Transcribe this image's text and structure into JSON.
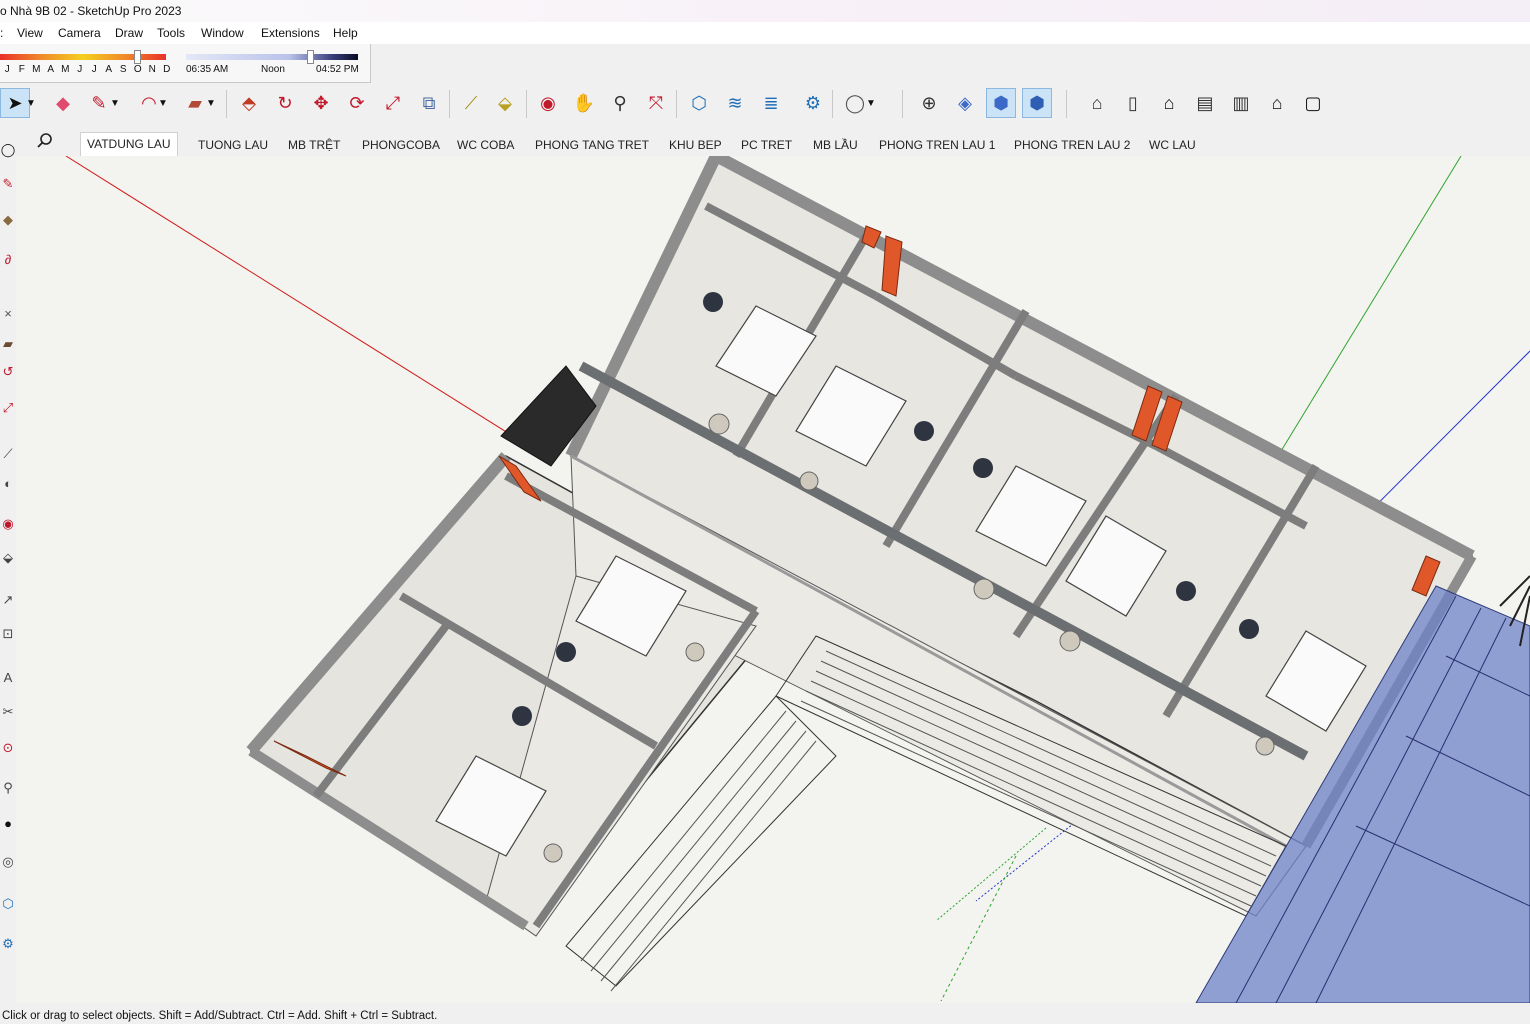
{
  "window": {
    "title": "o Nhà 9B 02 - SketchUp Pro 2023"
  },
  "menu": [
    "View",
    "Camera",
    "Draw",
    "Tools",
    "Window",
    "Extensions",
    "Help"
  ],
  "shadows": {
    "months": [
      "J",
      "F",
      "M",
      "A",
      "M",
      "J",
      "J",
      "A",
      "S",
      "O",
      "N",
      "D"
    ],
    "month_position": 0.81,
    "time_start": "06:35 AM",
    "time_noon": "Noon",
    "time_end": "04:52 PM",
    "time_position": 0.7
  },
  "toolbar": {
    "tools": [
      {
        "name": "select-icon",
        "glyph": "➤"
      },
      {
        "name": "eraser-icon",
        "glyph": "◆"
      },
      {
        "name": "pencil-icon",
        "glyph": "✎"
      },
      {
        "name": "arc-icon",
        "glyph": "◠"
      },
      {
        "name": "rectangle-icon",
        "glyph": "▰"
      },
      {
        "name": "push-pull-icon",
        "glyph": "⬘"
      },
      {
        "name": "follow-me-icon",
        "glyph": "↻"
      },
      {
        "name": "move-icon",
        "glyph": "✥"
      },
      {
        "name": "rotate-icon",
        "glyph": "⟳"
      },
      {
        "name": "scale-icon",
        "glyph": "⤢"
      },
      {
        "name": "offset-icon",
        "glyph": "⧉"
      },
      {
        "name": "tape-measure-icon",
        "glyph": "⟋"
      },
      {
        "name": "paint-bucket-icon",
        "glyph": "⬙"
      },
      {
        "name": "orbit-icon",
        "glyph": "◉"
      },
      {
        "name": "pan-icon",
        "glyph": "✋"
      },
      {
        "name": "zoom-icon",
        "glyph": "⚲"
      },
      {
        "name": "zoom-extents-icon",
        "glyph": "⤧"
      },
      {
        "name": "warehouse-icon",
        "glyph": "⬡"
      },
      {
        "name": "extension-warehouse-icon",
        "glyph": "≋"
      },
      {
        "name": "layout-icon",
        "glyph": "≣"
      },
      {
        "name": "extension-manager-icon",
        "glyph": "⚙"
      },
      {
        "name": "account-icon",
        "glyph": "◯"
      },
      {
        "name": "section-plane-icon",
        "glyph": "⊕"
      },
      {
        "name": "xray-icon",
        "glyph": "◈"
      },
      {
        "name": "back-edges-icon",
        "glyph": "⬢"
      },
      {
        "name": "shaded-icon",
        "glyph": "⬢"
      },
      {
        "name": "iso-view-icon",
        "glyph": "⌂"
      },
      {
        "name": "top-view-icon",
        "glyph": "▯"
      },
      {
        "name": "front-view-icon",
        "glyph": "⌂"
      },
      {
        "name": "right-view-icon",
        "glyph": "▤"
      },
      {
        "name": "back-view-icon",
        "glyph": "▥"
      },
      {
        "name": "left-view-icon",
        "glyph": "⌂"
      },
      {
        "name": "bottom-view-icon",
        "glyph": "▢"
      }
    ]
  },
  "scene_tabs": [
    "VATDUNG LAU",
    "TUONG LAU",
    "MB TRỆT",
    "PHONGCOBA",
    "WC COBA",
    "PHONG TANG TRET",
    "KHU BEP",
    "PC TRET",
    "MB LẦU",
    "PHONG TREN LAU 1",
    "PHONG TREN LAU 2",
    "WC LAU"
  ],
  "active_tab": "VATDUNG LAU",
  "status": "Click or drag to select objects. Shift = Add/Subtract. Ctrl = Add. Shift + Ctrl = Subtract.",
  "colors": {
    "axis_red": "#d21a1a",
    "axis_green": "#2ea52e",
    "axis_blue": "#2233cc",
    "wall_gray": "#8d8d8d",
    "floor_marble": "#e9e7e2",
    "accent_orange": "#e0582a",
    "glass_blue": "#6f83c8"
  }
}
